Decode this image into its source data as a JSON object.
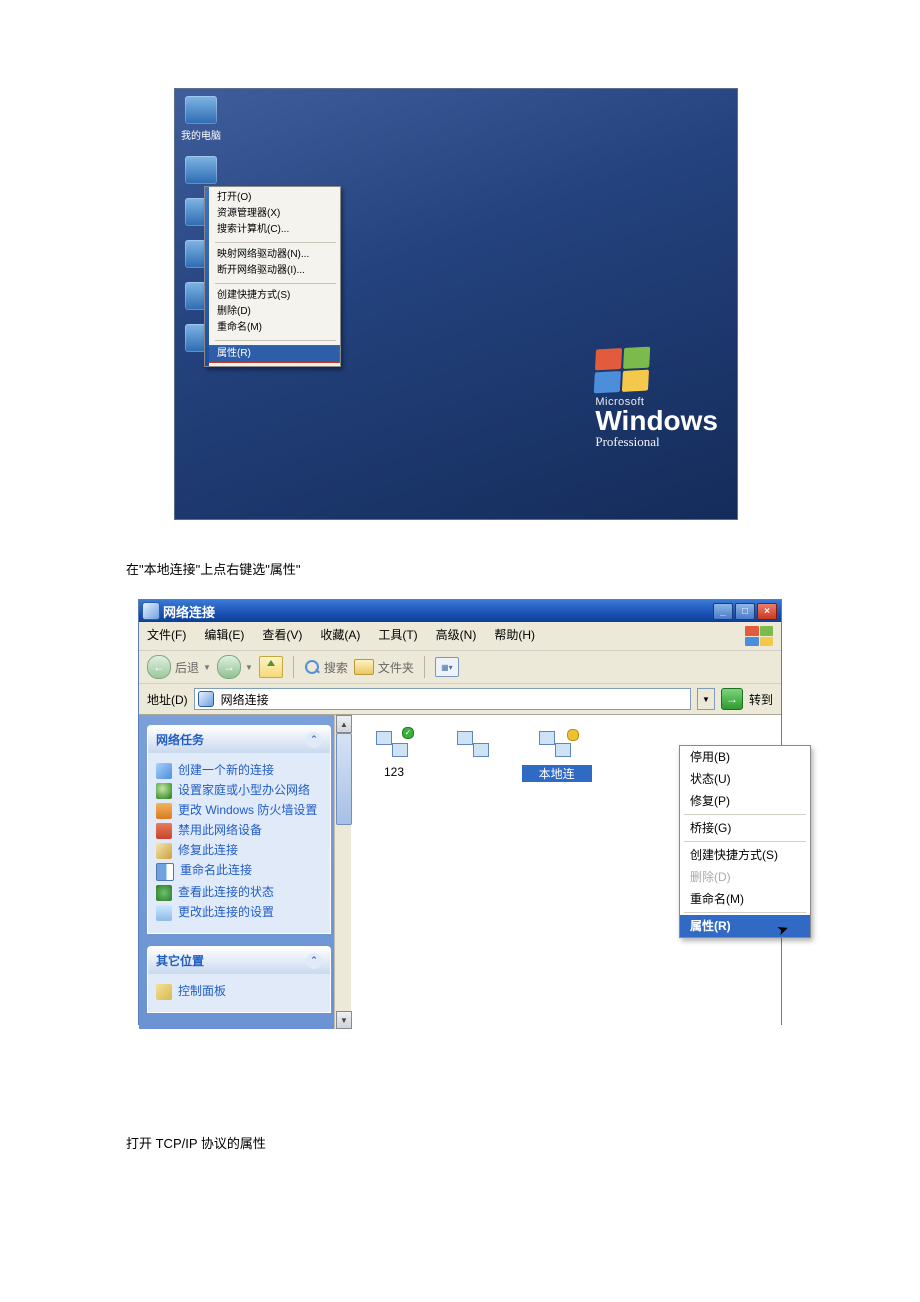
{
  "desktop": {
    "icons": [
      {
        "label": "我的电脑"
      },
      {
        "label": ""
      },
      {
        "label": ""
      },
      {
        "label": ""
      },
      {
        "label": ""
      },
      {
        "label": ""
      }
    ],
    "context_menu": {
      "group1": [
        "打开(O)",
        "资源管理器(X)",
        "搜索计算机(C)..."
      ],
      "group2": [
        "映射网络驱动器(N)...",
        "断开网络驱动器(I)..."
      ],
      "group3": [
        "创建快捷方式(S)",
        "删除(D)",
        "重命名(M)"
      ],
      "highlight": "属性(R)"
    },
    "brand": {
      "ms": "Microsoft",
      "win": "Windows",
      "pro": "Professional"
    }
  },
  "caption1": "在\"本地连接\"上点右键选\"属性\"",
  "caption2": "打开 TCP/IP  协议的属性",
  "nc_window": {
    "title": "网络连接",
    "menu": {
      "file": "文件(F)",
      "edit": "编辑(E)",
      "view": "查看(V)",
      "fav": "收藏(A)",
      "tools": "工具(T)",
      "adv": "高级(N)",
      "help": "帮助(H)"
    },
    "toolbar": {
      "back": "后退",
      "search": "搜索",
      "folders": "文件夹"
    },
    "addr": {
      "label": "地址(D)",
      "value": "网络连接",
      "go": "转到"
    },
    "sidebar": {
      "panel1_title": "网络任务",
      "tasks": [
        "创建一个新的连接",
        "设置家庭或小型办公网络",
        "更改 Windows 防火墙设置",
        "禁用此网络设备",
        "修复此连接",
        "重命名此连接",
        "查看此连接的状态",
        "更改此连接的设置"
      ],
      "panel2_title": "其它位置",
      "other_first": "控制面板"
    },
    "connections": {
      "conn1": "123",
      "conn2": "",
      "conn3_sel": "本地连"
    },
    "ctx2": {
      "items": [
        "停用(B)",
        "状态(U)",
        "修复(P)",
        "桥接(G)",
        "创建快捷方式(S)",
        "删除(D)",
        "重命名(M)"
      ],
      "highlight": "属性(R)"
    }
  }
}
